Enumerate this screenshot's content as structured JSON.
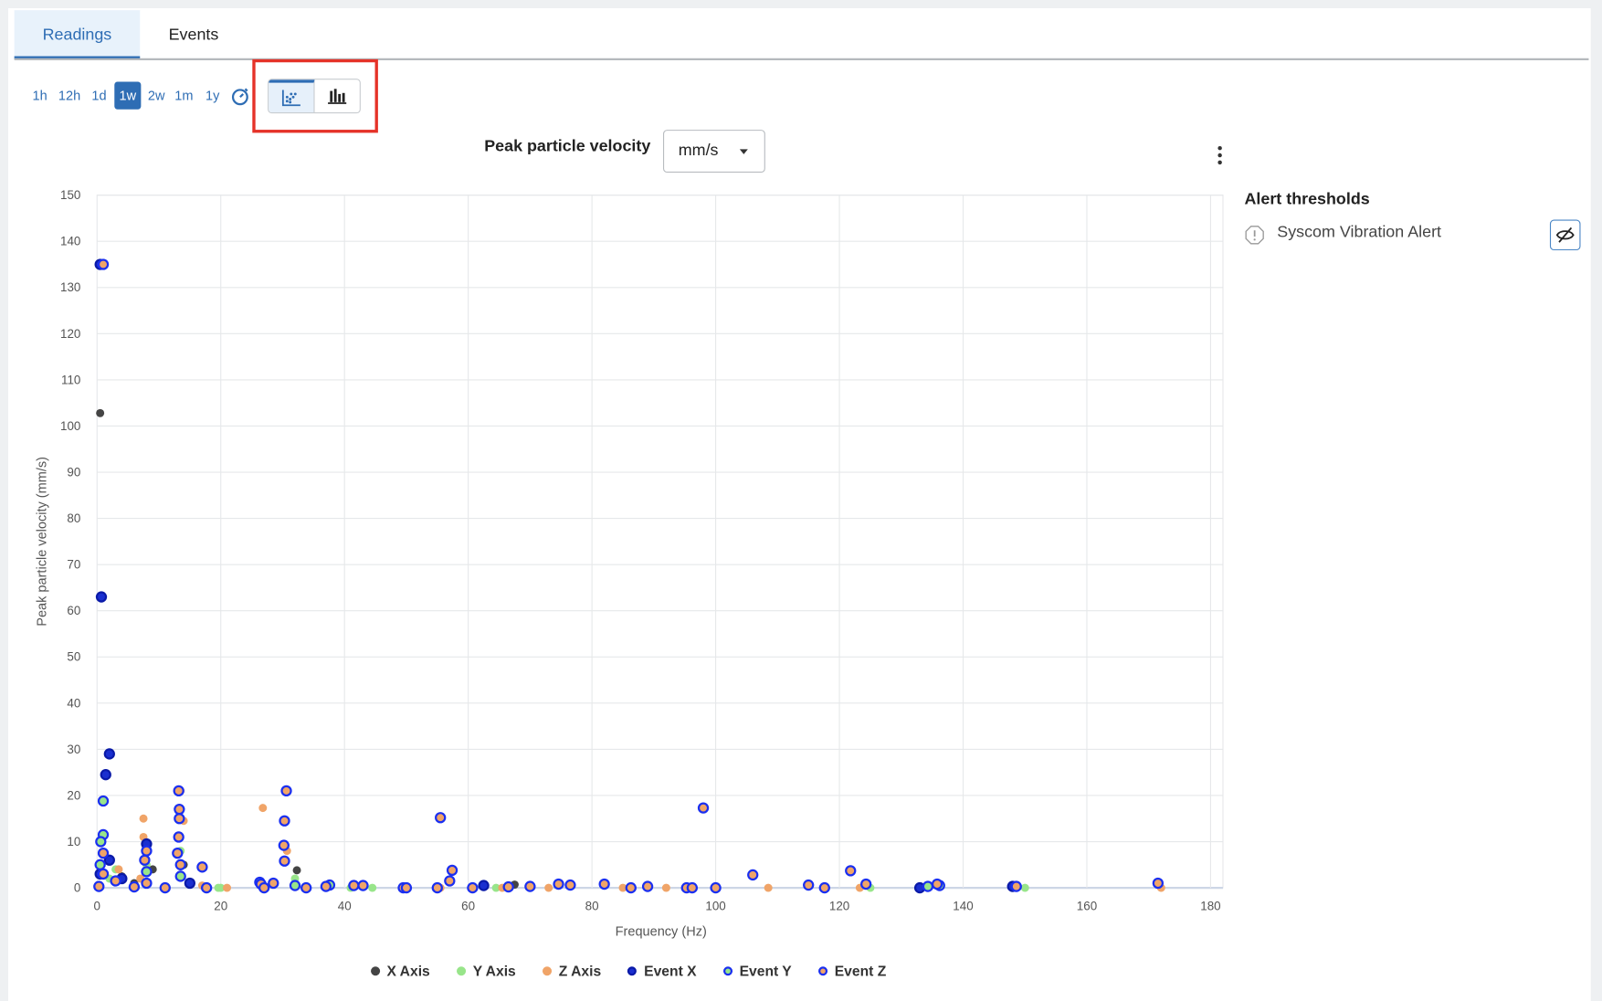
{
  "tabs": [
    {
      "label": "Readings",
      "active": true
    },
    {
      "label": "Events",
      "active": false
    }
  ],
  "ranges": [
    "1h",
    "12h",
    "1d",
    "1w",
    "2w",
    "1m",
    "1y"
  ],
  "selected_range": "1w",
  "icons": {
    "custom_range": "stopwatch-icon",
    "scatter": "scatter-chart-icon",
    "bar": "bar-chart-icon",
    "menu": "kebab-icon",
    "alert": "alert-octagon-icon",
    "hide": "eye-slash-icon"
  },
  "chart_header": {
    "title": "Peak particle velocity",
    "unit": "mm/s"
  },
  "alerts": {
    "title": "Alert thresholds",
    "items": [
      {
        "label": "Syscom Vibration Alert"
      }
    ]
  },
  "colors": {
    "accent": "#2e6db4",
    "highlight": "#e53228"
  },
  "chart_data": {
    "type": "scatter",
    "xlabel": "Frequency (Hz)",
    "ylabel": "Peak particle velocity (mm/s)",
    "xlim": [
      0,
      182
    ],
    "ylim": [
      0,
      150
    ],
    "xticks": [
      0,
      20,
      40,
      60,
      80,
      100,
      120,
      140,
      160,
      180
    ],
    "yticks": [
      0,
      10,
      20,
      30,
      40,
      50,
      60,
      70,
      80,
      90,
      100,
      110,
      120,
      130,
      140,
      150
    ],
    "grid": true,
    "legend": "bottom",
    "series": [
      {
        "name": "X Axis",
        "fill": "#444444",
        "stroke": "#444444",
        "points": [
          [
            0.5,
            102.8
          ],
          [
            32.3,
            3.8
          ],
          [
            4,
            2.5
          ],
          [
            9,
            4
          ],
          [
            14,
            5
          ],
          [
            67.5,
            0.7
          ],
          [
            62.5,
            0.6
          ],
          [
            133,
            0
          ],
          [
            148.6,
            0.2
          ],
          [
            6,
            1
          ]
        ]
      },
      {
        "name": "Y Axis",
        "fill": "#98e58a",
        "stroke": "#98e58a",
        "points": [
          [
            3,
            4
          ],
          [
            13.5,
            8
          ],
          [
            19.6,
            0
          ],
          [
            20,
            0
          ],
          [
            41,
            0
          ],
          [
            44.5,
            0
          ],
          [
            64.5,
            0
          ],
          [
            125,
            0
          ],
          [
            150,
            0
          ],
          [
            32,
            2
          ],
          [
            8,
            5
          ],
          [
            2,
            2
          ]
        ]
      },
      {
        "name": "Z Axis",
        "fill": "#f0a468",
        "stroke": "#f0a468",
        "points": [
          [
            3.5,
            4
          ],
          [
            7.5,
            15
          ],
          [
            7.5,
            11
          ],
          [
            13.5,
            21
          ],
          [
            14,
            14.5
          ],
          [
            26.8,
            17.3
          ],
          [
            30.7,
            8
          ],
          [
            21,
            0
          ],
          [
            55.5,
            0
          ],
          [
            65.5,
            0
          ],
          [
            73,
            0
          ],
          [
            85,
            0
          ],
          [
            92,
            0
          ],
          [
            108.5,
            0
          ],
          [
            123.3,
            0
          ],
          [
            172,
            0
          ],
          [
            7,
            2
          ],
          [
            17,
            0.5
          ]
        ]
      },
      {
        "name": "Event X",
        "fill": "#1a2fd0",
        "stroke": "#0a1aa8",
        "points": [
          [
            0.5,
            135
          ],
          [
            0.7,
            63
          ],
          [
            2,
            29
          ],
          [
            1.4,
            24.5
          ],
          [
            8,
            9.5
          ],
          [
            133,
            0
          ],
          [
            148,
            0.3
          ],
          [
            62.5,
            0.5
          ],
          [
            2,
            6
          ],
          [
            0.5,
            3
          ],
          [
            4,
            2
          ],
          [
            15,
            1
          ]
        ]
      },
      {
        "name": "Event Y",
        "fill": "#98e58a",
        "stroke": "#1a2ff0",
        "points": [
          [
            1,
            11.5
          ],
          [
            0.6,
            10
          ],
          [
            1,
            18.8
          ],
          [
            26.3,
            1.2
          ],
          [
            13.5,
            2.5
          ],
          [
            32,
            0.5
          ],
          [
            37.6,
            0.6
          ],
          [
            134.3,
            0.3
          ],
          [
            136.2,
            0.5
          ],
          [
            8,
            3.5
          ],
          [
            0.5,
            5
          ]
        ]
      },
      {
        "name": "Event Z",
        "fill": "#f0a468",
        "stroke": "#1a2ff0",
        "points": [
          [
            1,
            135
          ],
          [
            1,
            7.5
          ],
          [
            13.2,
            21
          ],
          [
            30.6,
            21
          ],
          [
            55.5,
            15.2
          ],
          [
            98,
            17.3
          ],
          [
            30.3,
            14.5
          ],
          [
            13.3,
            15
          ],
          [
            13.3,
            17
          ],
          [
            121.8,
            3.7
          ],
          [
            106,
            2.8
          ],
          [
            57.4,
            3.8
          ],
          [
            17,
            4.5
          ],
          [
            30.2,
            9.2
          ],
          [
            30.3,
            5.8
          ],
          [
            8,
            8
          ],
          [
            7.7,
            6
          ],
          [
            13,
            7.5
          ],
          [
            13.2,
            11
          ],
          [
            1,
            3
          ],
          [
            3,
            1.5
          ],
          [
            115,
            0.6
          ],
          [
            117.6,
            0
          ],
          [
            124.3,
            0.8
          ],
          [
            171.5,
            1
          ],
          [
            100,
            0
          ],
          [
            95.3,
            0
          ],
          [
            96.2,
            0
          ],
          [
            89,
            0.3
          ],
          [
            86.3,
            0
          ],
          [
            82,
            0.8
          ],
          [
            76.5,
            0.6
          ],
          [
            74.6,
            0.8
          ],
          [
            70,
            0.3
          ],
          [
            66.5,
            0.2
          ],
          [
            60.7,
            0
          ],
          [
            55,
            0
          ],
          [
            49.5,
            0
          ],
          [
            50,
            0
          ],
          [
            43,
            0.5
          ],
          [
            41.5,
            0.5
          ],
          [
            37,
            0.3
          ],
          [
            33.8,
            0
          ],
          [
            28.5,
            1
          ],
          [
            26.5,
            0.8
          ],
          [
            27,
            0
          ],
          [
            17.7,
            0
          ],
          [
            11,
            0
          ],
          [
            6,
            0.2
          ],
          [
            0.3,
            0.3
          ],
          [
            148.6,
            0.3
          ],
          [
            135.8,
            0.8
          ],
          [
            57,
            1.5
          ],
          [
            13.5,
            5
          ],
          [
            8,
            1
          ]
        ]
      }
    ]
  }
}
